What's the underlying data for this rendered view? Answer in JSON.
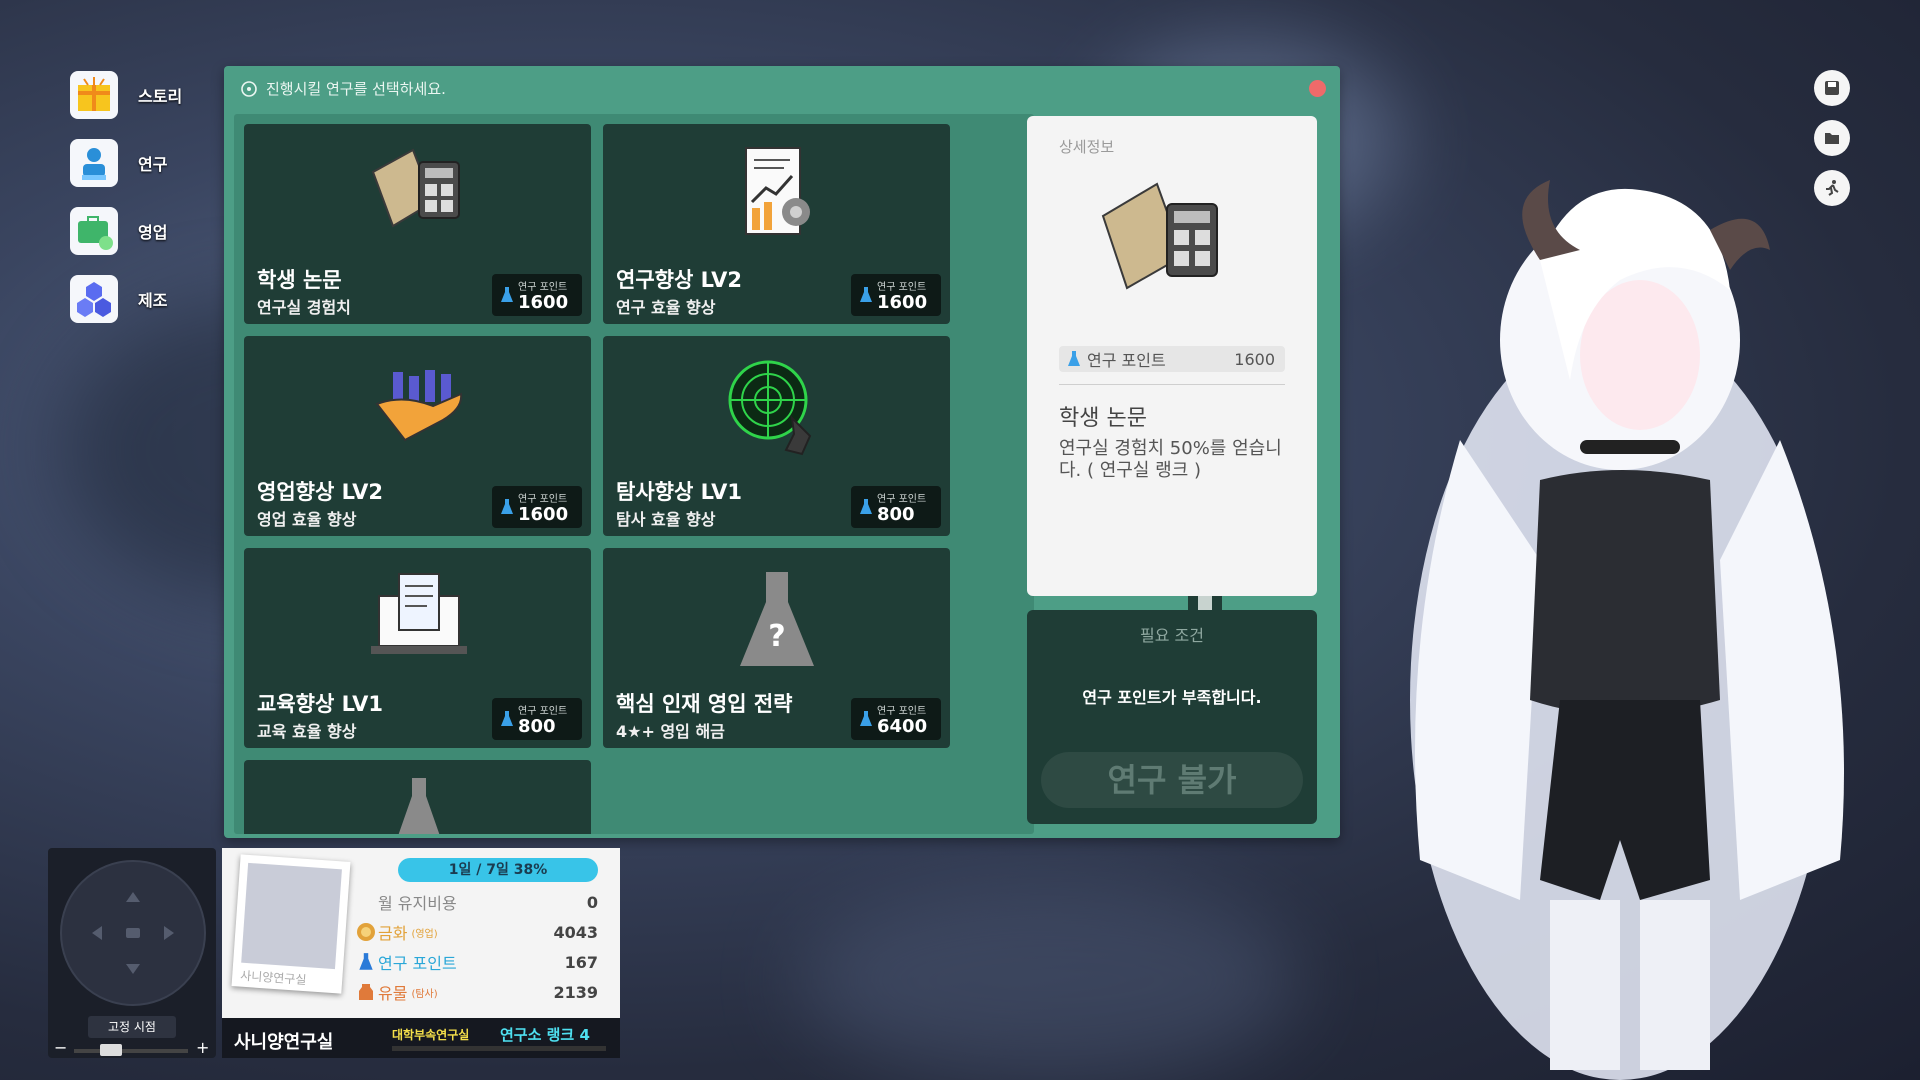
{
  "menu": [
    {
      "label": "스토리",
      "icon": "gift-icon"
    },
    {
      "label": "연구",
      "icon": "researcher-icon"
    },
    {
      "label": "영업",
      "icon": "briefcase-icon"
    },
    {
      "label": "제조",
      "icon": "cubes-icon"
    }
  ],
  "panel": {
    "header": "진행시킬 연구를 선택하세요."
  },
  "cost_label": "연구 포인트",
  "cards": [
    {
      "title": "학생 논문",
      "subtitle": "연구실 경험치",
      "cost": "1600",
      "icon": "folder-calculator-icon"
    },
    {
      "title": "연구향상 LV2",
      "subtitle": "연구 효율 향상",
      "cost": "1600",
      "icon": "report-chart-icon"
    },
    {
      "title": "영업향상 LV2",
      "subtitle": "영업 효율 향상",
      "cost": "1600",
      "icon": "hand-chart-icon"
    },
    {
      "title": "탐사향상 LV1",
      "subtitle": "탐사 효율 향상",
      "cost": "800",
      "icon": "radar-icon"
    },
    {
      "title": "교육향상 LV1",
      "subtitle": "교육 효율 향상",
      "cost": "800",
      "icon": "laptop-document-icon"
    },
    {
      "title": "핵심 인재 영입 전략",
      "subtitle": "4★+ 영입 해금",
      "cost": "6400",
      "icon": "unknown-flask-icon"
    }
  ],
  "detail": {
    "header": "상세정보",
    "rp_label": "연구 포인트",
    "rp_value": "1600",
    "name": "학생 논문",
    "desc": "연구실 경험치 50%를 얻습니다. ( 연구실 랭크 )"
  },
  "requirement": {
    "header": "필요 조건",
    "message": "연구 포인트가 부족합니다.",
    "button": "연구 불가"
  },
  "status": {
    "date": "1일 / 7일 38%",
    "rows": [
      {
        "label": "월 유지비용",
        "small": "",
        "value": "0",
        "color": "#888888"
      },
      {
        "label": "금화",
        "small": "(영업)",
        "value": "4043",
        "color": "#e2a23a"
      },
      {
        "label": "연구 포인트",
        "small": "",
        "value": "167",
        "color": "#2aa7d8"
      },
      {
        "label": "유물",
        "small": "(탐사)",
        "value": "2139",
        "color": "#e07a3a"
      }
    ],
    "lab_name": "사니양연구실",
    "dept": "대학부속연구실",
    "rank": "연구소 랭크 4",
    "photo_caption": "사니양연구실"
  },
  "minimap": {
    "fixed_view": "고정 시점",
    "minus": "−",
    "plus": "+"
  }
}
